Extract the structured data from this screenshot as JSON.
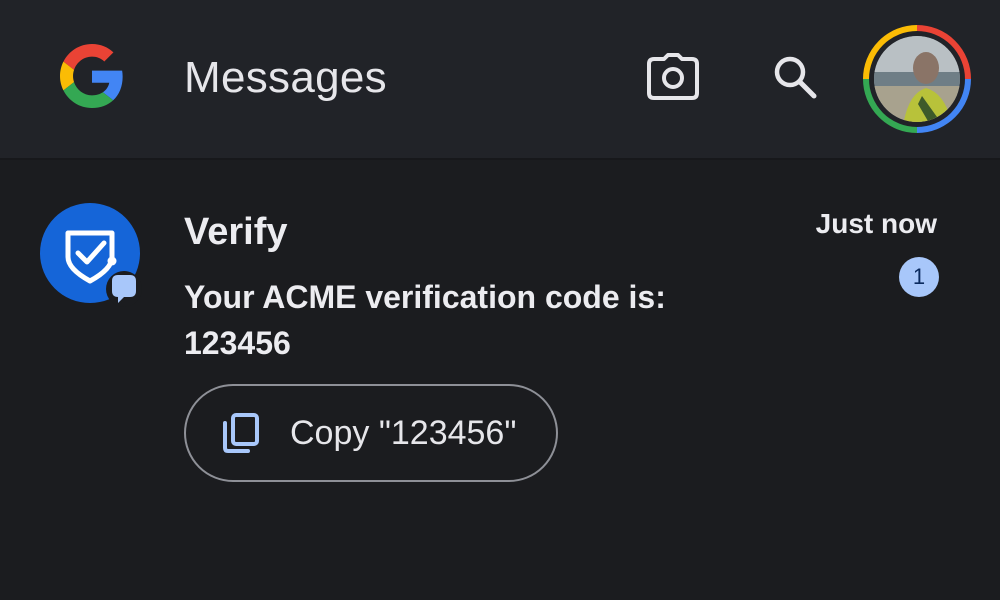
{
  "header": {
    "app_title": "Messages",
    "logo_icon": "google-g-icon",
    "actions": [
      {
        "icon": "camera-icon"
      },
      {
        "icon": "search-icon"
      },
      {
        "icon": "account-avatar"
      }
    ]
  },
  "conversation": {
    "sender": "Verify",
    "avatar_icon": "verified-sender-icon",
    "avatar_color": "#1565d8",
    "snippet_lines": [
      "Your ACME verification code is:",
      "123456"
    ],
    "timestamp": "Just now",
    "unread_count": "1",
    "badge_color": "#a8c7fa",
    "copy_action": {
      "icon": "copy-icon",
      "label": "Copy \"123456\""
    }
  },
  "colors": {
    "background": "#1b1c1f",
    "header_background": "#212328",
    "accent_blue": "#a8c7fa"
  }
}
